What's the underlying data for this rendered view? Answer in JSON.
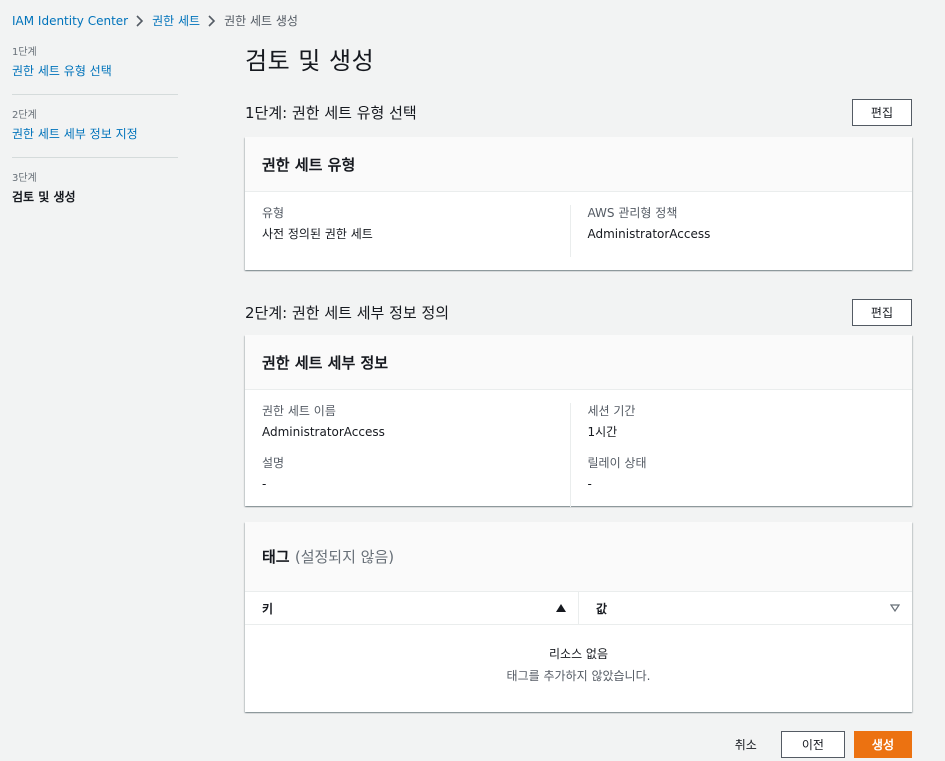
{
  "breadcrumb": {
    "items": [
      "IAM Identity Center",
      "권한 세트",
      "권한 세트 생성"
    ]
  },
  "steps": [
    {
      "num": "1단계",
      "title": "권한 세트 유형 선택"
    },
    {
      "num": "2단계",
      "title": "권한 세트 세부 정보 지정"
    },
    {
      "num": "3단계",
      "title": "검토 및 생성"
    }
  ],
  "page_title": "검토 및 생성",
  "section1": {
    "heading": "1단계: 권한 세트 유형 선택",
    "edit_label": "편집",
    "card_title": "권한 세트 유형",
    "fields": [
      {
        "label": "유형",
        "value": "사전 정의된 권한 세트"
      },
      {
        "label": "AWS 관리형 정책",
        "value": "AdministratorAccess"
      }
    ]
  },
  "section2": {
    "heading": "2단계: 권한 세트 세부 정보 정의",
    "edit_label": "편집",
    "card_title": "권한 세트 세부 정보",
    "fields": [
      {
        "label": "권한 세트 이름",
        "value": "AdministratorAccess"
      },
      {
        "label": "설명",
        "value": "-"
      },
      {
        "label": "세션 기간",
        "value": "1시간"
      },
      {
        "label": "릴레이 상태",
        "value": "-"
      }
    ]
  },
  "tags": {
    "title": "태그",
    "subtitle": "(설정되지 않음)",
    "columns": [
      "키",
      "값"
    ],
    "empty_title": "리소스 없음",
    "empty_desc": "태그를 추가하지 않았습니다."
  },
  "footer": {
    "cancel": "취소",
    "previous": "이전",
    "create": "생성"
  },
  "colors": {
    "link": "#0073bb",
    "primary": "#ec7211",
    "background": "#f2f3f3"
  }
}
